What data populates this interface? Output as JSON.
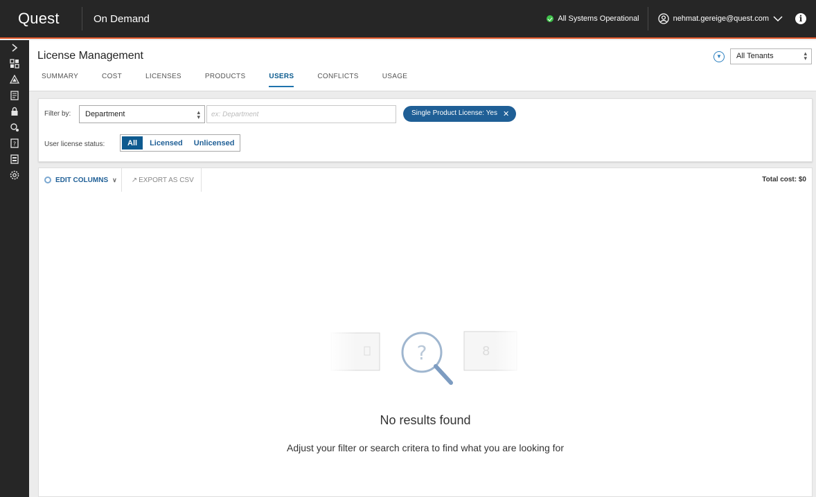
{
  "topbar": {
    "logo": "Quest",
    "product": "On Demand",
    "status": "All Systems Operational",
    "user_email": "nehmat.gereige@quest.com",
    "accent_color": "#e3582a"
  },
  "leftnav": {
    "icons": [
      "chevron-right-icon",
      "dashboard-icon",
      "alerts-icon",
      "reports-icon",
      "lock-icon",
      "migration-icon",
      "help-icon",
      "documents-icon",
      "settings-icon"
    ]
  },
  "header": {
    "title": "License Management",
    "tabs": [
      {
        "label": "SUMMARY",
        "active": false
      },
      {
        "label": "COST",
        "active": false
      },
      {
        "label": "LICENSES",
        "active": false
      },
      {
        "label": "PRODUCTS",
        "active": false
      },
      {
        "label": "USERS",
        "active": true
      },
      {
        "label": "CONFLICTS",
        "active": false
      },
      {
        "label": "USAGE",
        "active": false
      }
    ],
    "tenant_value": "All Tenants"
  },
  "filters": {
    "filter_label": "Filter by:",
    "field_value": "Department",
    "input_placeholder": "ex: Department",
    "chip_label": "Single Product License: Yes",
    "status_label": "User license status:",
    "status_options": [
      "All",
      "Licensed",
      "Unlicensed"
    ],
    "status_selected": "All"
  },
  "results": {
    "edit_columns": "EDIT COLUMNS",
    "export": "EXPORT AS CSV",
    "total_cost": "Total cost: $0",
    "empty_title": "No results found",
    "empty_message": "Adjust your filter or search critera to find what you are looking for"
  }
}
